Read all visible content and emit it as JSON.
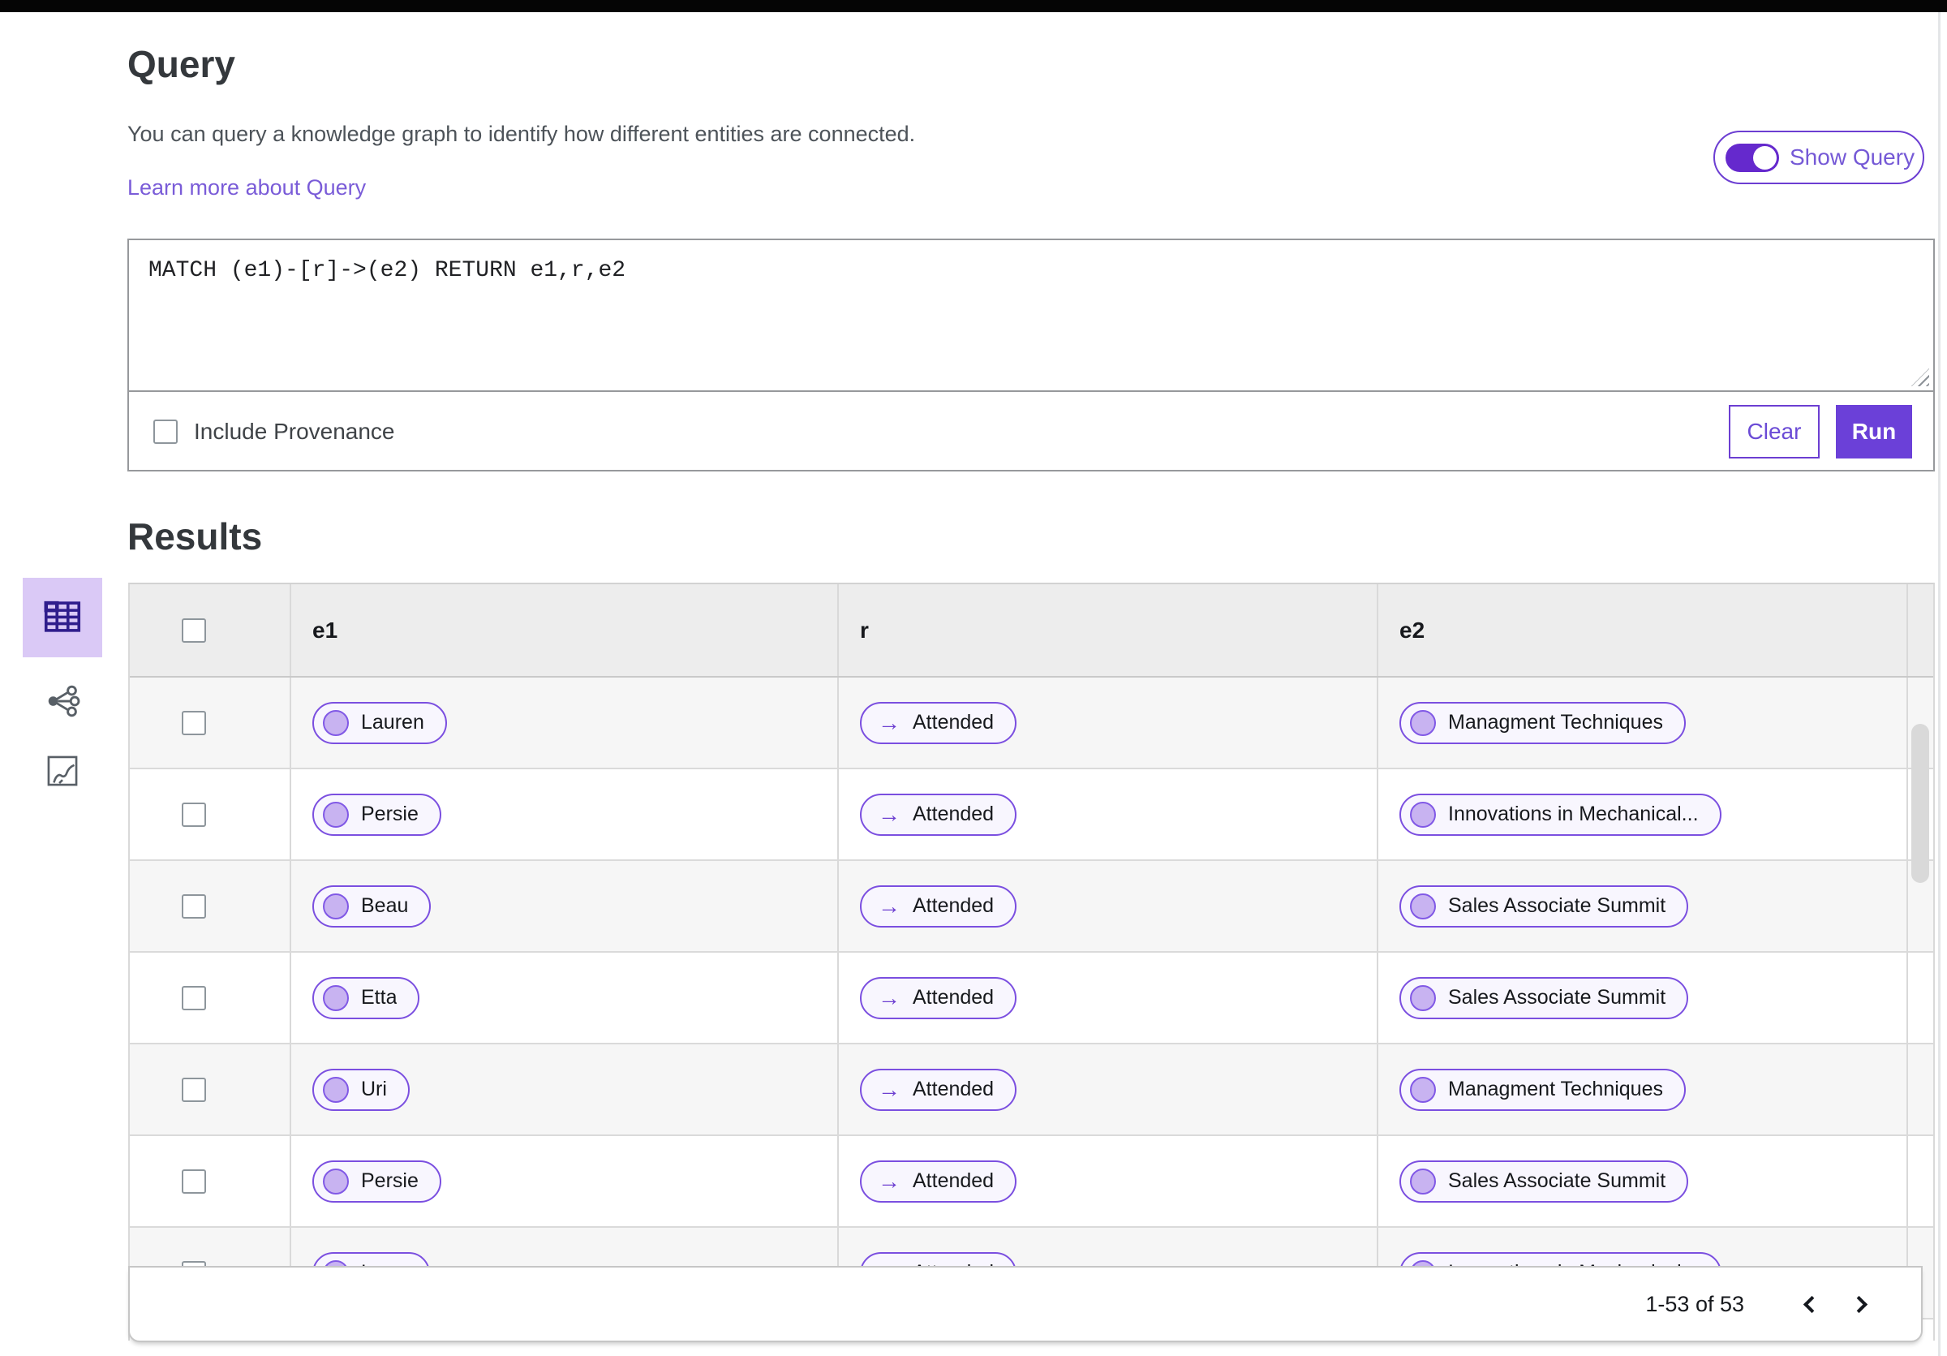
{
  "header": {
    "title": "Query",
    "description": "You can query a knowledge graph to identify how different entities are connected.",
    "learn_more": "Learn more about Query",
    "show_query_toggle": {
      "label": "Show Query",
      "state": "on"
    }
  },
  "query_editor": {
    "query": "MATCH (e1)-[r]->(e2) RETURN e1,r,e2",
    "include_provenance": {
      "label": "Include Provenance",
      "checked": false
    },
    "clear_button": "Clear",
    "run_button": "Run"
  },
  "results": {
    "heading": "Results",
    "views": [
      {
        "icon": "table-view-icon",
        "selected": true
      },
      {
        "icon": "graph-view-icon",
        "selected": false
      },
      {
        "icon": "canvas-view-icon",
        "selected": false
      }
    ],
    "table": {
      "columns": [
        "e1",
        "r",
        "e2"
      ],
      "relation_arrow": "→",
      "rows": [
        {
          "e1": "Lauren",
          "r": "Attended",
          "e2": "Managment Techniques"
        },
        {
          "e1": "Persie",
          "r": "Attended",
          "e2": "Innovations in Mechanical..."
        },
        {
          "e1": "Beau",
          "r": "Attended",
          "e2": "Sales Associate Summit"
        },
        {
          "e1": "Etta",
          "r": "Attended",
          "e2": "Sales Associate Summit"
        },
        {
          "e1": "Uri",
          "r": "Attended",
          "e2": "Managment Techniques"
        },
        {
          "e1": "Persie",
          "r": "Attended",
          "e2": "Sales Associate Summit"
        },
        {
          "e1": "Larry",
          "r": "Attended",
          "e2": "Innovations in Mechanical..."
        }
      ]
    },
    "pagination": {
      "range_label": "1-53 of 53"
    }
  },
  "colors": {
    "accent_purple": "#6b40d8",
    "pill_border": "#7b4fe0",
    "pill_bg": "#f8f6fe",
    "node_fill": "#c8b3f1",
    "selected_view_bg": "#dac9f6",
    "link": "#7a5cd8",
    "table_header_bg": "#ededed",
    "row_stripe": "#f6f6f6"
  }
}
